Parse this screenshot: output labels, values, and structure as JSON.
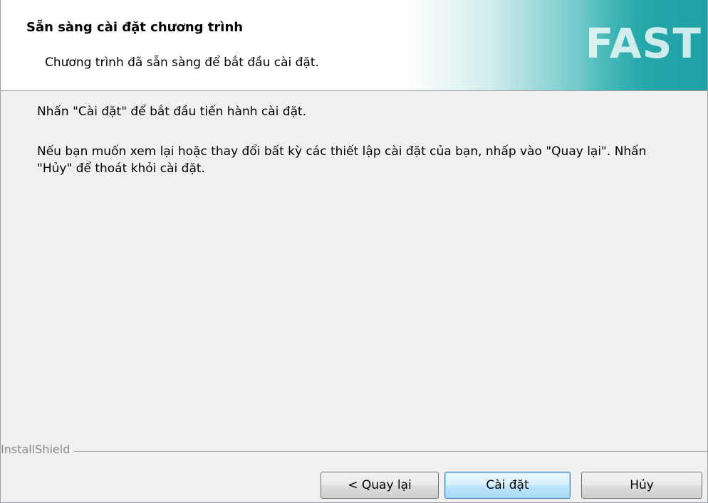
{
  "header": {
    "title": "Sẵn sàng cài đặt chương trình",
    "subtitle": "Chương trình đã sẵn sàng để bắt đầu cài đặt.",
    "logo_text": "FAST",
    "accent_color": "#2aa9ab"
  },
  "body": {
    "paragraph_1": "Nhấn \"Cài đặt\" để bắt đầu tiến hành cài đặt.",
    "paragraph_2": "Nếu bạn muốn xem lại hoặc thay đổi bất kỳ các thiết lập cài đặt của bạn, nhấp vào \"Quay lại\". Nhấn \"Hủy\" để thoát khỏi cài đặt."
  },
  "footer": {
    "brand_label": "InstallShield"
  },
  "buttons": {
    "back_label": "< Quay lại",
    "install_label": "Cài đặt",
    "cancel_label": "Hủy"
  }
}
